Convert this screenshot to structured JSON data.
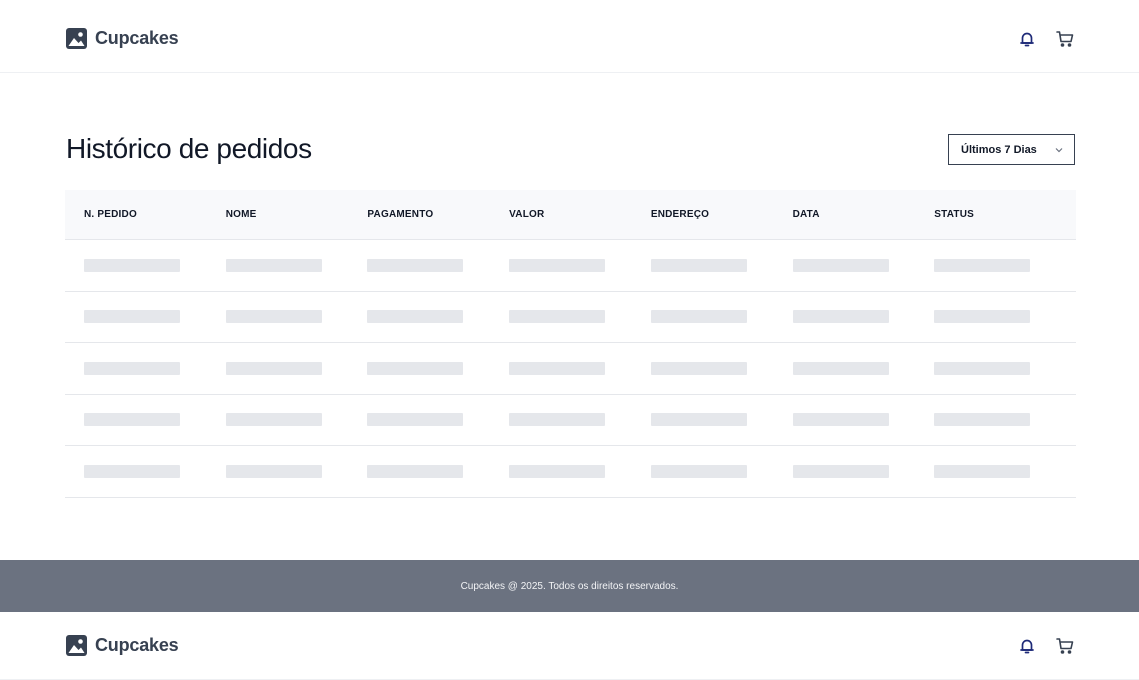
{
  "brand": {
    "name": "Cupcakes"
  },
  "nav": {
    "icons": [
      "bell-icon",
      "cart-icon"
    ]
  },
  "page": {
    "title": "Histórico de pedidos"
  },
  "filter": {
    "selected": "Últimos 7 Dias"
  },
  "table": {
    "columns": [
      "N. PEDIDO",
      "NOME",
      "PAGAMENTO",
      "VALOR",
      "ENDEREÇO",
      "DATA",
      "STATUS"
    ],
    "loading_rows": 5
  },
  "footer": {
    "text": "Cupcakes @ 2025. Todos os direitos reservados."
  },
  "colors": {
    "footer_bg": "#6b7280",
    "skeleton": "#e5e7eb",
    "table_header_bg": "#f8f9fb",
    "bell_accent": "#1e2a78"
  }
}
